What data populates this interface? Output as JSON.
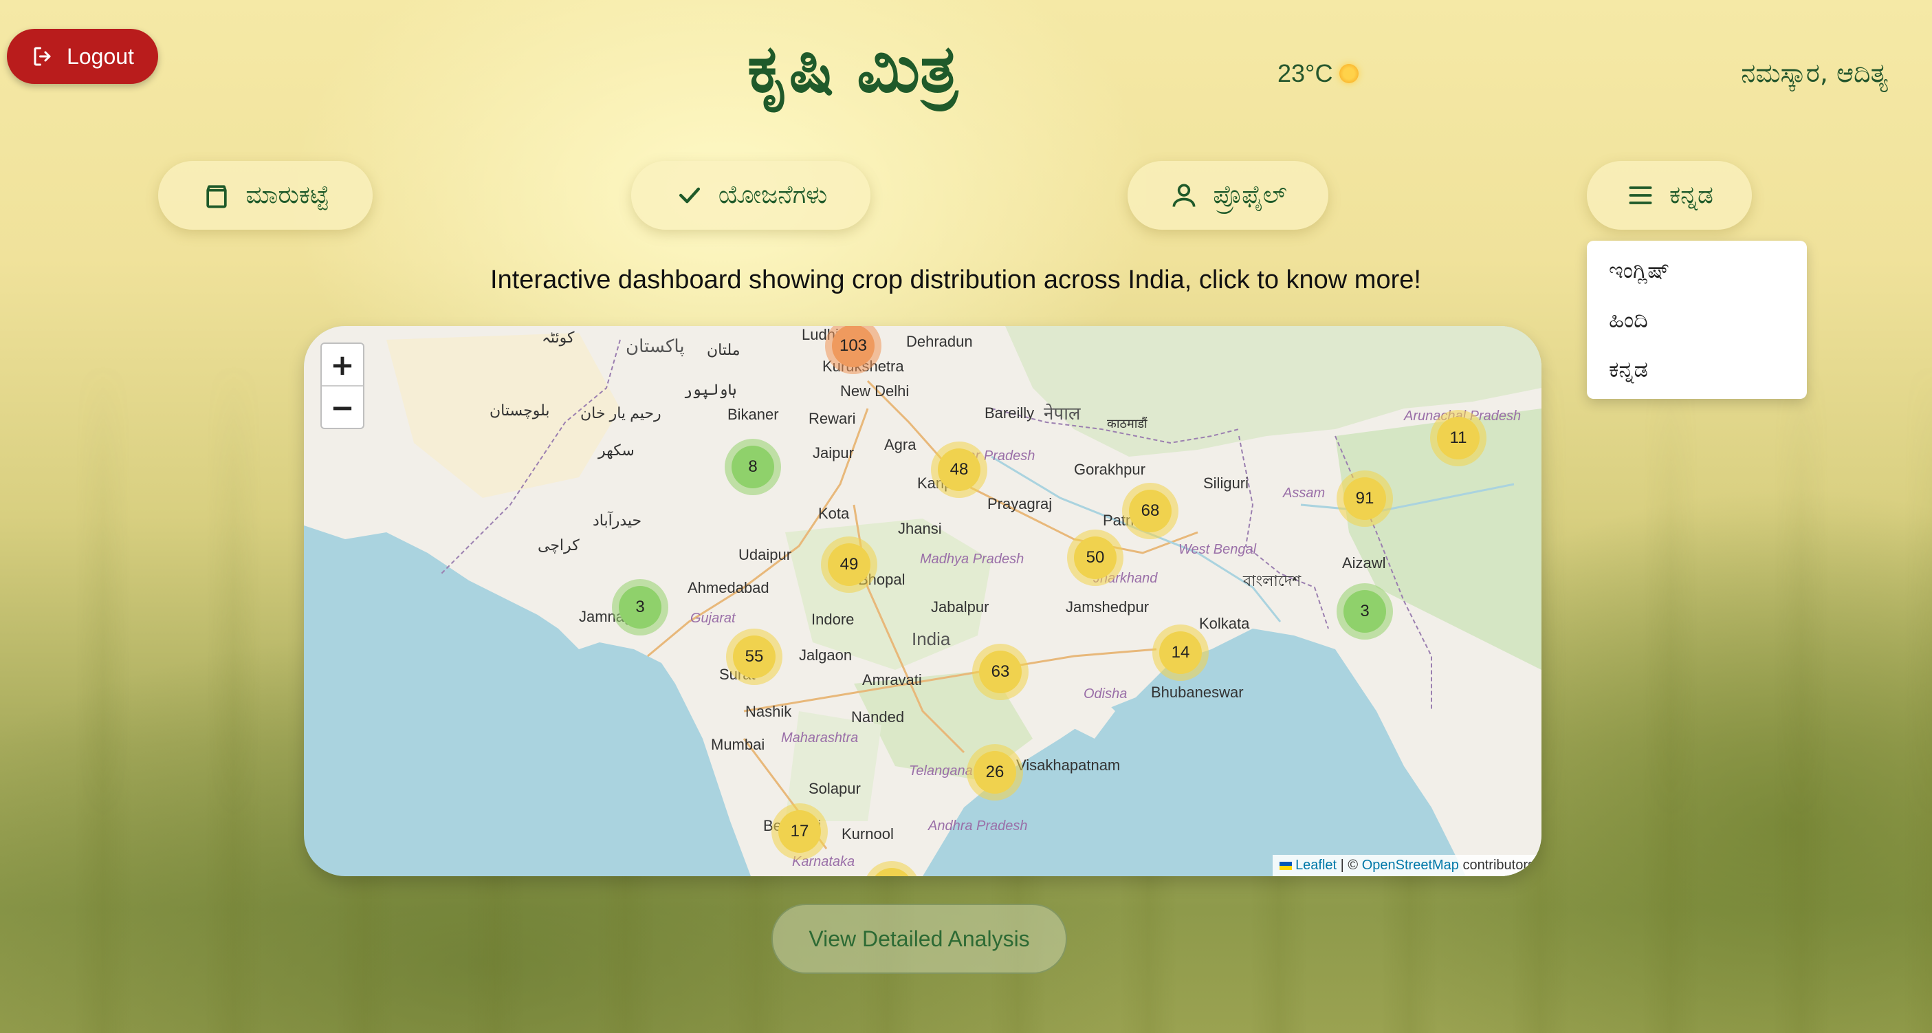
{
  "header": {
    "logout_label": "Logout",
    "app_title": "ಕೃಷಿ ಮಿತ್ರ",
    "weather": "23°C",
    "greeting": "ನಮಸ್ಕಾರ, ಆದಿತ್ಯ"
  },
  "nav": {
    "market": "ಮಾರುಕಟ್ಟೆ",
    "schemes": "ಯೋಜನೆಗಳು",
    "profile": "ಪ್ರೊಫೈಲ್",
    "language": "ಕನ್ನಡ"
  },
  "language_menu": {
    "options": [
      "ಇಂಗ್ಲಿಷ್",
      "ಹಿಂದಿ",
      "ಕನ್ನಡ"
    ]
  },
  "subtitle": "Interactive dashboard showing crop distribution across India, click to know more!",
  "map": {
    "zoom_in": "+",
    "zoom_out": "−",
    "clusters": [
      "103",
      "8",
      "48",
      "68",
      "91",
      "11",
      "49",
      "50",
      "3",
      "55",
      "14",
      "3",
      "63",
      "26",
      "17"
    ],
    "places": [
      "Ludhi",
      "Dehradun",
      "Kurukshetra",
      "New Delhi",
      "Bikaner",
      "Rewari",
      "Bareilly",
      "नेपाल",
      "काठमाडौं",
      "Agra",
      "Jaipur",
      "Uttar Pradesh",
      "Gorakhpur",
      "Siliguri",
      "Kanpur",
      "Prayagraj",
      "Assam",
      "Patna",
      "Kota",
      "Jhansi",
      "Udaipur",
      "Bhopal",
      "Madhya Pradesh",
      "West Bengal",
      "Jharkhand",
      "Aizawl",
      "Ahmedabad",
      "Jabalpur",
      "Jamshedpur",
      "বাংলাদেশ",
      "Jamnagar",
      "Gujarat",
      "Indore",
      "India",
      "Kolkata",
      "Surat",
      "Jalgaon",
      "Amravati",
      "Odisha",
      "Bhubaneswar",
      "Nashik",
      "Nanded",
      "Maharashtra",
      "Mumbai",
      "Telangana",
      "Visakhapatnam",
      "Solapur",
      "Kurnool",
      "Andhra Pradesh",
      "Belagavi",
      "Karnataka",
      "Arunachal Pradesh",
      "كراچى",
      "ملتان",
      "پاکستان",
      "بلوچستان",
      "سکھر",
      "حیدرآباد",
      "کوئٹہ",
      "ہاولپور",
      "رحیم یار خان"
    ],
    "attribution_leaflet": "Leaflet",
    "attribution_sep": " | © ",
    "attribution_osm": "OpenStreetMap",
    "attribution_tail": " contributors"
  },
  "analysis_button": "View Detailed Analysis",
  "colors": {
    "logout_bg": "#b91c1c",
    "brand_green": "#1f5a2a",
    "cluster_small": "#8fd16b",
    "cluster_medium": "#f2d34d",
    "cluster_large": "#f29a5a"
  }
}
